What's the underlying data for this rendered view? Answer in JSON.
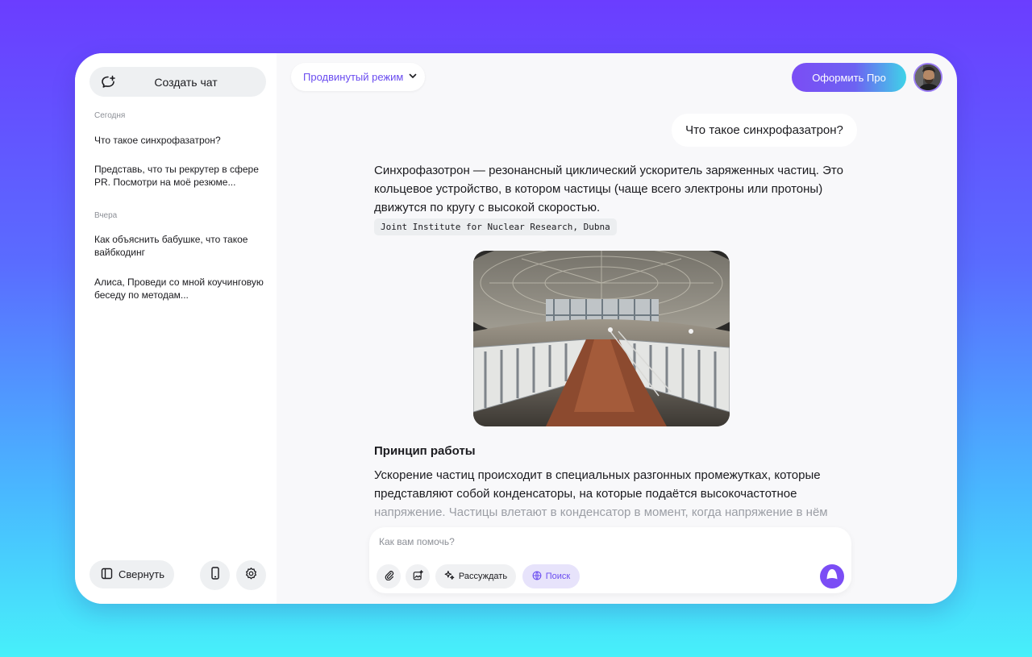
{
  "sidebar": {
    "create_chat": "Создать чат",
    "sections": [
      {
        "label": "Сегодня",
        "items": [
          "Что такое синхрофазатрон?",
          "Представь, что ты рекрутер в сфере PR. Посмотри на моё резюме..."
        ]
      },
      {
        "label": "Вчера",
        "items": [
          "Как объяснить бабушке, что такое вайбкодинг",
          "Алиса, Проведи со мной коучинговую беседу по методам..."
        ]
      }
    ],
    "collapse_label": "Свернуть"
  },
  "header": {
    "mode_label": "Продвинутый режим",
    "pro_label": "Оформить Про"
  },
  "chat": {
    "user_message": "Что такое синхрофазатрон?",
    "answer_para1": "Синхрофазотрон — резонансный циклический ускоритель заряженных частиц. Это кольцевое устройство, в котором частицы (чаще всего электроны или протоны) движутся по кругу с высокой скоростью.",
    "source_chip": "Joint Institute for Nuclear Research, Dubna",
    "section_title": "Принцип работы",
    "answer_para2_main": "Ускорение частиц происходит в специальных разгонных промежутках, которые представляют собой конденсаторы, на которые подаётся высокочастотное ",
    "answer_para2_fade": "напряжение. Частицы влетают в конденсатор в момент, когда напряжение в нём"
  },
  "composer": {
    "placeholder": "Как вам помочь?",
    "think_label": "Рассуждать",
    "search_label": "Поиск"
  },
  "colors": {
    "accent": "#7b4df5",
    "accent_text": "#6a4cf0",
    "sidebar_bg": "#ffffff",
    "chat_bg": "#f8f8fa"
  }
}
